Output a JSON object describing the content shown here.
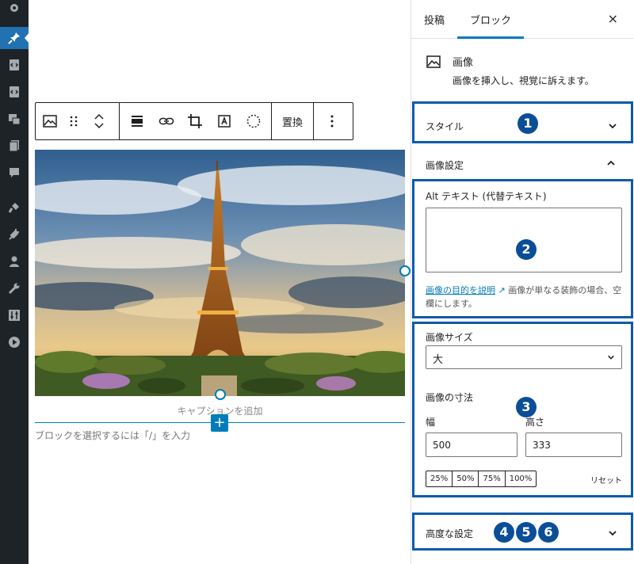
{
  "admin_menu": {
    "icons": [
      "settings-icon",
      "pin-icon",
      "code-icon",
      "code-icon",
      "media-icon",
      "pages-icon",
      "comments-icon",
      "appearance-icon",
      "plugins-icon",
      "users-icon",
      "tools-icon",
      "settings-sliders-icon",
      "play-icon"
    ],
    "active": "pin-icon"
  },
  "toolbar": {
    "replace_label": "置換"
  },
  "canvas": {
    "caption_placeholder": "キャプションを追加",
    "block_placeholder": "ブロックを選択するには「/」を入力",
    "inserter": "+"
  },
  "sidebar": {
    "tabs": [
      {
        "label": "投稿"
      },
      {
        "label": "ブロック"
      }
    ],
    "close": "×",
    "block_card": {
      "title": "画像",
      "description": "画像を挿入し、視覚に訴えます。"
    },
    "style_panel": {
      "title": "スタイル",
      "badge": "1"
    },
    "image_settings": {
      "title": "画像設定",
      "alt_label": "Alt テキスト (代替テキスト)",
      "alt_value": "",
      "alt_help_link": "画像の目的を説明",
      "alt_help_text": "画像が単なる装飾の場合、空欄にします。",
      "badge_alt": "2",
      "size_label": "画像サイズ",
      "size_value": "大",
      "dimensions_label": "画像の寸法",
      "width_label": "幅",
      "height_label": "高さ",
      "width_value": "500",
      "height_value": "333",
      "badge_size": "3",
      "presets": [
        "25%",
        "50%",
        "75%",
        "100%"
      ],
      "reset": "リセット"
    },
    "advanced_panel": {
      "title": "高度な設定",
      "badges": [
        "4",
        "5",
        "6"
      ]
    }
  },
  "colors": {
    "accent": "#007cba",
    "highlight_border": "#0a5bab",
    "badge": "#0a4e98",
    "admin_bg": "#1d2327",
    "admin_active": "#2271b1"
  }
}
